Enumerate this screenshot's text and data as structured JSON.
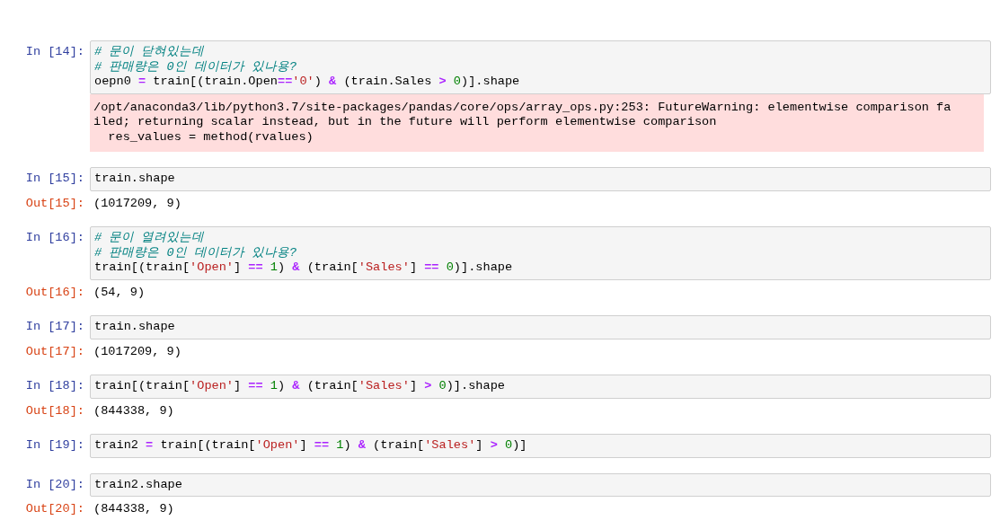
{
  "cells": [
    {
      "prompt": "In [14]:",
      "code": [
        [
          {
            "kind": "comment",
            "text": "# 문이 닫혀있는데"
          }
        ],
        [
          {
            "kind": "comment",
            "text": "# 판매량은 0인 데이터가 있나용?"
          }
        ],
        [
          {
            "kind": "plain",
            "text": "oepn0 "
          },
          {
            "kind": "op",
            "text": "="
          },
          {
            "kind": "plain",
            "text": " train[(train.Open"
          },
          {
            "kind": "op",
            "text": "=="
          },
          {
            "kind": "str",
            "text": "'0'"
          },
          {
            "kind": "plain",
            "text": ") "
          },
          {
            "kind": "op",
            "text": "&"
          },
          {
            "kind": "plain",
            "text": " (train.Sales "
          },
          {
            "kind": "op",
            "text": "> "
          },
          {
            "kind": "num",
            "text": "0"
          },
          {
            "kind": "plain",
            "text": ")].shape"
          }
        ]
      ],
      "output": {
        "kind": "stderr",
        "lines": [
          "/opt/anaconda3/lib/python3.7/site-packages/pandas/core/ops/array_ops.py:253: FutureWarning: elementwise comparison fa",
          "iled; returning scalar instead, but in the future will perform elementwise comparison",
          "  res_values = method(rvalues)"
        ]
      }
    },
    {
      "prompt": "In [15]:",
      "code": [
        [
          {
            "kind": "plain",
            "text": "train.shape"
          }
        ]
      ],
      "output": {
        "kind": "result",
        "prompt": "Out[15]:",
        "lines": [
          "(1017209, 9)"
        ]
      }
    },
    {
      "prompt": "In [16]:",
      "code": [
        [
          {
            "kind": "comment",
            "text": "# 문이 열려있는데"
          }
        ],
        [
          {
            "kind": "comment",
            "text": "# 판매량은 0인 데이터가 있나용?"
          }
        ],
        [
          {
            "kind": "plain",
            "text": "train[(train["
          },
          {
            "kind": "str",
            "text": "'Open'"
          },
          {
            "kind": "plain",
            "text": "] "
          },
          {
            "kind": "op",
            "text": "== "
          },
          {
            "kind": "num",
            "text": "1"
          },
          {
            "kind": "plain",
            "text": ") "
          },
          {
            "kind": "op",
            "text": "&"
          },
          {
            "kind": "plain",
            "text": " (train["
          },
          {
            "kind": "str",
            "text": "'Sales'"
          },
          {
            "kind": "plain",
            "text": "] "
          },
          {
            "kind": "op",
            "text": "== "
          },
          {
            "kind": "num",
            "text": "0"
          },
          {
            "kind": "plain",
            "text": ")].shape"
          }
        ]
      ],
      "output": {
        "kind": "result",
        "prompt": "Out[16]:",
        "lines": [
          "(54, 9)"
        ]
      }
    },
    {
      "prompt": "In [17]:",
      "code": [
        [
          {
            "kind": "plain",
            "text": "train.shape"
          }
        ]
      ],
      "output": {
        "kind": "result",
        "prompt": "Out[17]:",
        "lines": [
          "(1017209, 9)"
        ]
      }
    },
    {
      "prompt": "In [18]:",
      "code": [
        [
          {
            "kind": "plain",
            "text": "train[(train["
          },
          {
            "kind": "str",
            "text": "'Open'"
          },
          {
            "kind": "plain",
            "text": "] "
          },
          {
            "kind": "op",
            "text": "== "
          },
          {
            "kind": "num",
            "text": "1"
          },
          {
            "kind": "plain",
            "text": ") "
          },
          {
            "kind": "op",
            "text": "&"
          },
          {
            "kind": "plain",
            "text": " (train["
          },
          {
            "kind": "str",
            "text": "'Sales'"
          },
          {
            "kind": "plain",
            "text": "] "
          },
          {
            "kind": "op",
            "text": "> "
          },
          {
            "kind": "num",
            "text": "0"
          },
          {
            "kind": "plain",
            "text": ")].shape"
          }
        ]
      ],
      "output": {
        "kind": "result",
        "prompt": "Out[18]:",
        "lines": [
          "(844338, 9)"
        ]
      }
    },
    {
      "prompt": "In [19]:",
      "code": [
        [
          {
            "kind": "plain",
            "text": "train2 "
          },
          {
            "kind": "op",
            "text": "="
          },
          {
            "kind": "plain",
            "text": " train[(train["
          },
          {
            "kind": "str",
            "text": "'Open'"
          },
          {
            "kind": "plain",
            "text": "] "
          },
          {
            "kind": "op",
            "text": "== "
          },
          {
            "kind": "num",
            "text": "1"
          },
          {
            "kind": "plain",
            "text": ") "
          },
          {
            "kind": "op",
            "text": "&"
          },
          {
            "kind": "plain",
            "text": " (train["
          },
          {
            "kind": "str",
            "text": "'Sales'"
          },
          {
            "kind": "plain",
            "text": "] "
          },
          {
            "kind": "op",
            "text": "> "
          },
          {
            "kind": "num",
            "text": "0"
          },
          {
            "kind": "plain",
            "text": ")]"
          }
        ]
      ]
    },
    {
      "prompt": "In [20]:",
      "code": [
        [
          {
            "kind": "plain",
            "text": "train2.shape"
          }
        ]
      ],
      "output": {
        "kind": "result",
        "prompt": "Out[20]:",
        "lines": [
          "(844338, 9)"
        ]
      }
    }
  ]
}
